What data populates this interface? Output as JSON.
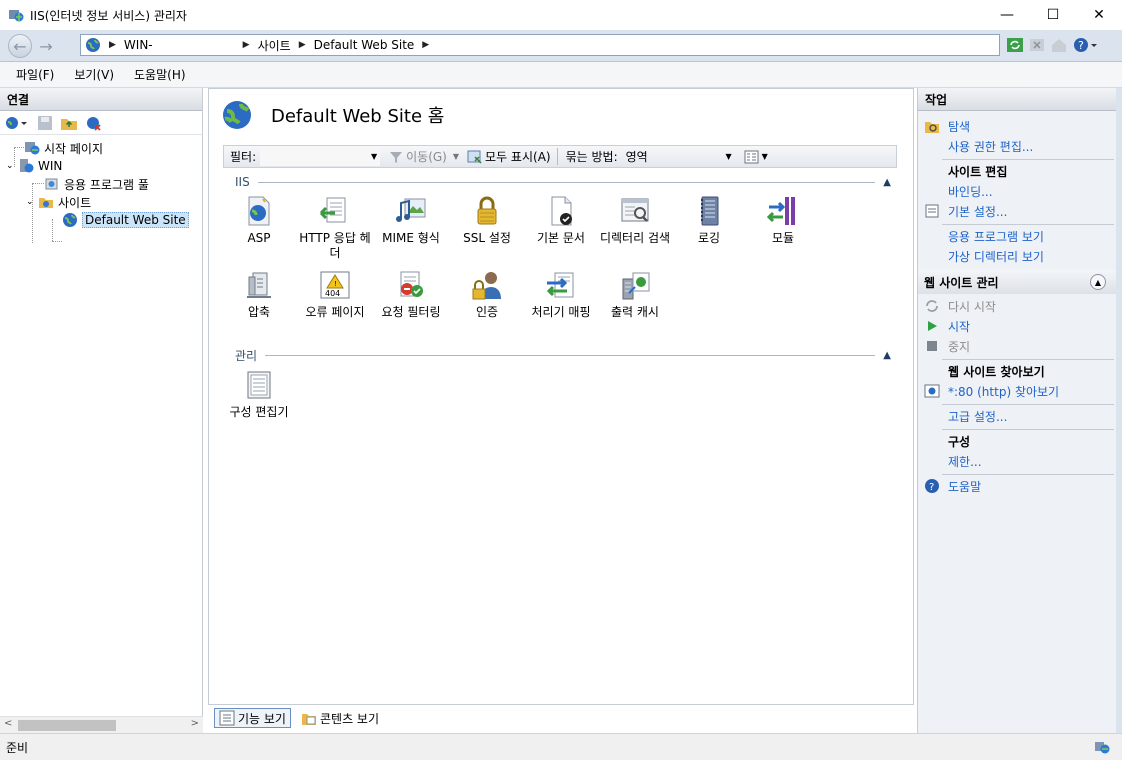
{
  "window": {
    "title": "IIS(인터넷 정보 서비스) 관리자",
    "minimize": "—",
    "maximize": "☐",
    "close": "✕"
  },
  "address": {
    "crumbs": [
      "WIN-",
      "사이트",
      "Default Web Site"
    ]
  },
  "menu": [
    "파일(F)",
    "보기(V)",
    "도움말(H)"
  ],
  "connections": {
    "header": "연결",
    "tree": {
      "start_page": "시작 페이지",
      "server": "WIN",
      "app_pools": "응용 프로그램 풀",
      "sites": "사이트",
      "default_site": "Default Web Site"
    }
  },
  "center": {
    "title": "Default Web Site 홈",
    "filter_label": "필터:",
    "go_label": "이동(G)",
    "show_all_label": "모두 표시(A)",
    "group_label": "묶는 방법:",
    "group_value": "영역",
    "sections": {
      "iis": "IIS",
      "management": "관리"
    },
    "features_row1": [
      {
        "name": "ASP",
        "icon": "asp-icon"
      },
      {
        "name": "HTTP 응답 헤더",
        "icon": "http-headers-icon"
      },
      {
        "name": "MIME 형식",
        "icon": "mime-icon"
      },
      {
        "name": "SSL 설정",
        "icon": "lock-icon"
      },
      {
        "name": "기본 문서",
        "icon": "default-document-icon"
      },
      {
        "name": "디렉터리 검색",
        "icon": "directory-browsing-icon"
      },
      {
        "name": "로깅",
        "icon": "logging-icon"
      },
      {
        "name": "모듈",
        "icon": "modules-icon"
      }
    ],
    "features_row2": [
      {
        "name": "압축",
        "icon": "compression-icon"
      },
      {
        "name": "오류 페이지",
        "icon": "error-pages-icon"
      },
      {
        "name": "요청 필터링",
        "icon": "request-filtering-icon"
      },
      {
        "name": "인증",
        "icon": "authentication-icon"
      },
      {
        "name": "처리기 매핑",
        "icon": "handler-mappings-icon"
      },
      {
        "name": "출력 캐시",
        "icon": "output-cache-icon"
      }
    ],
    "management_features": [
      {
        "name": "구성 편집기",
        "icon": "config-editor-icon"
      }
    ],
    "error_icon_text": "404"
  },
  "view_tabs": {
    "features": "기능 보기",
    "content": "콘텐츠 보기"
  },
  "actions": {
    "header": "작업",
    "explore": "탐색",
    "edit_permissions": "사용 권한 편집...",
    "edit_site_head": "사이트 편집",
    "bindings": "바인딩...",
    "basic_settings": "기본 설정...",
    "view_applications": "응용 프로그램 보기",
    "view_virtual_dirs": "가상 디렉터리 보기",
    "manage_site_head": "웹 사이트 관리",
    "restart": "다시 시작",
    "start": "시작",
    "stop": "중지",
    "browse_head": "웹 사이트 찾아보기",
    "browse_80": "*:80 (http) 찾아보기",
    "advanced_settings": "고급 설정...",
    "config_head": "구성",
    "limits": "제한...",
    "help": "도움말"
  },
  "status": {
    "text": "준비"
  }
}
